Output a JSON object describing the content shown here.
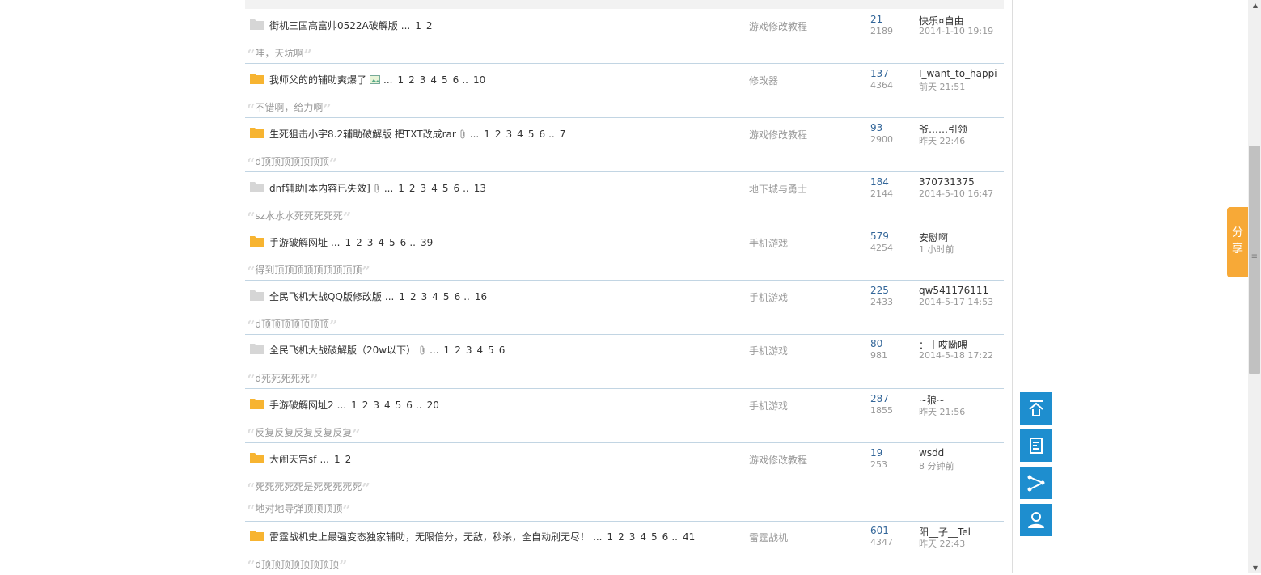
{
  "threads": [
    {
      "title": "街机三国高富帅0522A破解版",
      "folder": "gray",
      "pages": [
        "1",
        "2"
      ],
      "dots": "",
      "forum": "游戏修改教程",
      "replies": "21",
      "views": "2189",
      "last_user": "快乐¤自由",
      "last_time": "2014-1-10 19:19",
      "quote": "哇，天坑啊"
    },
    {
      "title": "我师父的的辅助爽爆了",
      "folder": "orange",
      "image": true,
      "pages": [
        "1",
        "2",
        "3",
        "4",
        "5",
        "6",
        "10"
      ],
      "dots": "..",
      "forum": "修改器",
      "replies": "137",
      "views": "4364",
      "last_user": "I_want_to_happi",
      "last_time": "前天 21:51",
      "quote": "不错啊，给力啊"
    },
    {
      "title": "生死狙击小宇8.2辅助破解版 把TXT改成rar",
      "folder": "orange",
      "attachment": true,
      "pages": [
        "1",
        "2",
        "3",
        "4",
        "5",
        "6",
        "7"
      ],
      "dots": "..",
      "forum": "游戏修改教程",
      "replies": "93",
      "views": "2900",
      "last_user": "爷……引领",
      "last_time": "昨天 22:46",
      "quote": "d顶顶顶顶顶顶顶"
    },
    {
      "title": "dnf辅助[本内容已失效]",
      "folder": "gray",
      "attachment": true,
      "pages": [
        "1",
        "2",
        "3",
        "4",
        "5",
        "6",
        "13"
      ],
      "dots": "..",
      "forum": "地下城与勇士",
      "replies": "184",
      "views": "2144",
      "last_user": "370731375",
      "last_time": "2014-5-10 16:47",
      "quote": "sz水水水死死死死死"
    },
    {
      "title": "手游破解网址",
      "folder": "orange",
      "pages": [
        "1",
        "2",
        "3",
        "4",
        "5",
        "6",
        "39"
      ],
      "dots": "..",
      "forum": "手机游戏",
      "replies": "579",
      "views": "4254",
      "last_user": "安慰啊",
      "last_time": "1 小时前",
      "quote": "得到顶顶顶顶顶顶顶顶顶"
    },
    {
      "title": "全民飞机大战QQ版修改版",
      "folder": "gray",
      "pages": [
        "1",
        "2",
        "3",
        "4",
        "5",
        "6",
        "16"
      ],
      "dots": "..",
      "forum": "手机游戏",
      "replies": "225",
      "views": "2433",
      "last_user": "qw541176111",
      "last_time": "2014-5-17 14:53",
      "quote": "d顶顶顶顶顶顶顶"
    },
    {
      "title": "全民飞机大战破解版（20w以下）",
      "folder": "gray",
      "attachment": true,
      "pages": [
        "1",
        "2",
        "3",
        "4",
        "5",
        "6"
      ],
      "dots": "",
      "forum": "手机游戏",
      "replies": "80",
      "views": "981",
      "last_user": "：丨哎呦喂",
      "last_time": "2014-5-18 17:22",
      "quote": "d死死死死死"
    },
    {
      "title": "手游破解网址2",
      "folder": "orange",
      "pages": [
        "1",
        "2",
        "3",
        "4",
        "5",
        "6",
        "20"
      ],
      "dots": "..",
      "forum": "手机游戏",
      "replies": "287",
      "views": "1855",
      "last_user": "~狼~",
      "last_time": "昨天 21:56",
      "quote": "反复反复反复反复反复"
    },
    {
      "title": "大闹天宫sf",
      "folder": "orange",
      "pages": [
        "1",
        "2"
      ],
      "dots": "",
      "forum": "游戏修改教程",
      "replies": "19",
      "views": "253",
      "last_user": "wsdd",
      "last_time": "8 分钟前",
      "quote": "死死死死死是死死死死死"
    },
    {
      "title": "雷霆战机史上最强变态独家辅助，无限倍分，无敌，秒杀，全自动刷无尽！",
      "folder": "orange",
      "pages": [
        "1",
        "2",
        "3",
        "4",
        "5",
        "6",
        "41"
      ],
      "dots": "..",
      "forum": "雷霆战机",
      "replies": "601",
      "views": "4347",
      "last_user": "阳__子__Tel",
      "last_time": "昨天 22:43",
      "quote": "d顶顶顶顶顶顶顶顶"
    }
  ],
  "extra_quote": "地对地导弹顶顶顶顶",
  "ellipsis": "...",
  "share_tab": {
    "line1": "分",
    "line2": "享"
  },
  "side_buttons": [
    "back-to-top-icon",
    "post-icon",
    "share-icon",
    "user-icon"
  ]
}
